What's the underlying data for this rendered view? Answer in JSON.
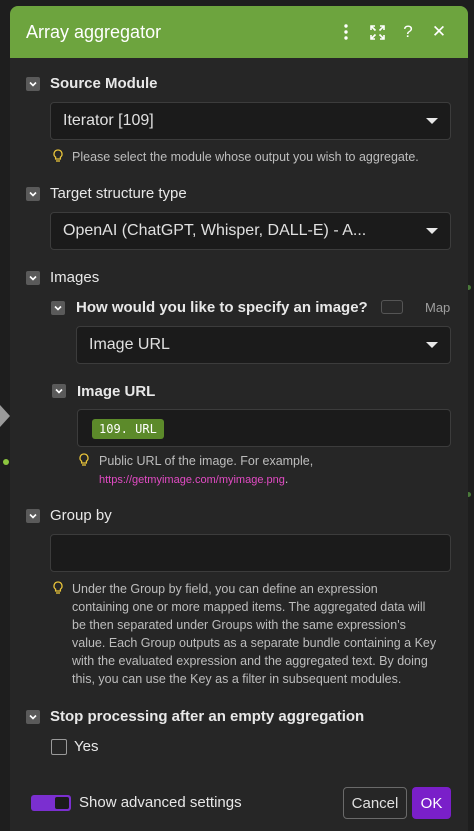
{
  "header": {
    "title": "Array aggregator",
    "icons": [
      "more-vertical-icon",
      "expand-icon",
      "help-icon",
      "close-icon"
    ],
    "help_glyph": "?",
    "close_glyph": "✕",
    "bg_color": "#6da43e"
  },
  "source_module": {
    "label": "Source Module",
    "value": "Iterator [109]",
    "hint": "Please select the module whose output you wish to aggregate."
  },
  "target_structure": {
    "label": "Target structure type",
    "value": "OpenAI (ChatGPT, Whisper, DALL-E) - A..."
  },
  "images": {
    "label": "Images",
    "specify": {
      "label": "How would you like to specify an image?",
      "map_label": "Map",
      "value": "Image URL"
    },
    "image_url": {
      "label": "Image URL",
      "pill": "109. URL",
      "hint_text": "Public URL of the image. For example,",
      "hint_link": "https://getmyimage.com/myimage.png",
      "hint_end": "."
    }
  },
  "group_by": {
    "label": "Group by",
    "value": "",
    "hint": [
      "Under the Group by field, you can define an expression",
      "containing one or more mapped items. The aggregated data will",
      "be then separated under Groups with the same expression's",
      "value. Each Group outputs as a separate bundle containing a Key",
      "with the evaluated expression and the aggregated text. By doing",
      "this, you can use the Key as a filter in subsequent modules."
    ]
  },
  "stop_processing": {
    "label": "Stop processing after an empty aggregation",
    "option": "Yes"
  },
  "footer": {
    "advanced_label": "Show advanced settings",
    "cancel_label": "Cancel",
    "ok_label": "OK",
    "ok_color": "#7a1fc9",
    "toggle_color": "#7b2fd0"
  }
}
